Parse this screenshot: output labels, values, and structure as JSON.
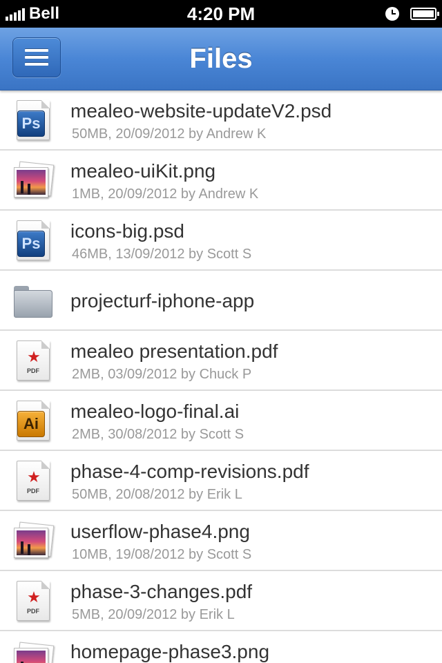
{
  "status_bar": {
    "carrier": "Bell",
    "time": "4:20 PM",
    "signal_icon": "signal-bars-icon",
    "alarm_icon": "clock-icon",
    "battery_icon": "battery-icon"
  },
  "nav": {
    "title": "Files",
    "menu_icon": "hamburger-menu-icon"
  },
  "colors": {
    "nav_blue": "#4a86d6",
    "file_name": "#333333",
    "file_meta": "#999999",
    "divider": "#dcdcdc"
  },
  "files": [
    {
      "name": "mealeo-website-updateV2.psd",
      "meta": "50MB, 20/09/2012 by Andrew K",
      "type": "psd",
      "badge": "Ps"
    },
    {
      "name": "mealeo-uiKit.png",
      "meta": "1MB, 20/09/2012 by Andrew K",
      "type": "png"
    },
    {
      "name": "icons-big.psd",
      "meta": "46MB, 13/09/2012 by Scott S",
      "type": "psd",
      "badge": "Ps"
    },
    {
      "name": "projecturf-iphone-app",
      "meta": "",
      "type": "folder"
    },
    {
      "name": "mealeo presentation.pdf",
      "meta": "2MB, 03/09/2012 by Chuck P",
      "type": "pdf",
      "badge": "PDF"
    },
    {
      "name": "mealeo-logo-final.ai",
      "meta": "2MB, 30/08/2012 by Scott S",
      "type": "ai",
      "badge": "Ai"
    },
    {
      "name": "phase-4-comp-revisions.pdf",
      "meta": "50MB, 20/08/2012 by Erik L",
      "type": "pdf",
      "badge": "PDF"
    },
    {
      "name": "userflow-phase4.png",
      "meta": "10MB, 19/08/2012 by Scott S",
      "type": "png"
    },
    {
      "name": "phase-3-changes.pdf",
      "meta": "5MB, 20/09/2012 by Erik L",
      "type": "pdf",
      "badge": "PDF"
    },
    {
      "name": "homepage-phase3.png",
      "meta": "",
      "type": "png"
    }
  ]
}
